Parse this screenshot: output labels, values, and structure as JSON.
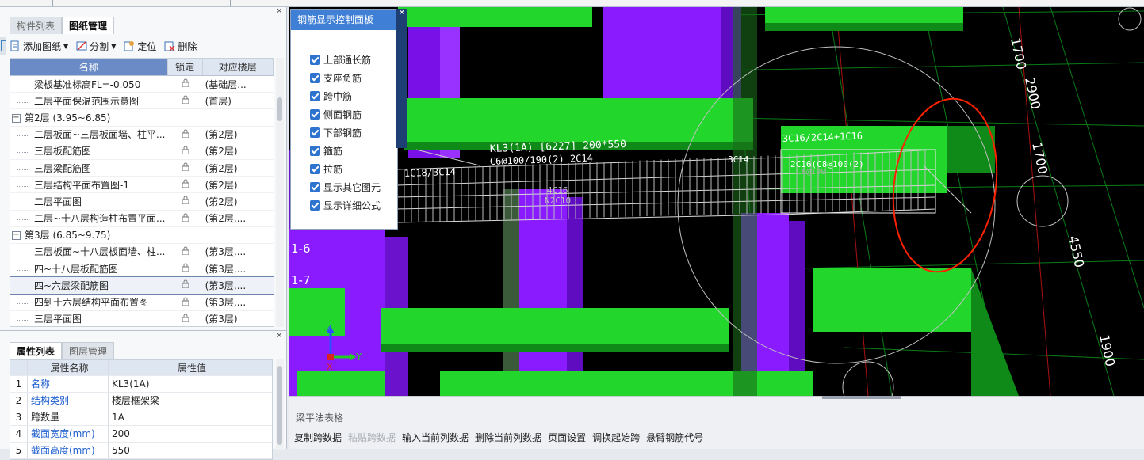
{
  "drawing_panel": {
    "tabs": [
      "构件列表",
      "图纸管理"
    ],
    "active_tab": 1,
    "toolbar": {
      "add_drawing": "添加图纸",
      "split": "分割",
      "locate": "定位",
      "delete": "删除"
    },
    "columns": {
      "name": "名称",
      "lock": "锁定",
      "floor": "对应楼层"
    },
    "rows": [
      {
        "type": "item",
        "name": "梁板基准标高FL=-0.050",
        "floor": "(基础层..."
      },
      {
        "type": "item",
        "name": "二层平面保温范围示意图",
        "floor": "(首层)"
      },
      {
        "type": "group",
        "name": "第2层 (3.95~6.85)",
        "floor": ""
      },
      {
        "type": "item",
        "name": "二层板面~三层板面墙、柱平...",
        "floor": "(第2层)"
      },
      {
        "type": "item",
        "name": "三层板配筋图",
        "floor": "(第2层)"
      },
      {
        "type": "item",
        "name": "三层梁配筋图",
        "floor": "(第2层)"
      },
      {
        "type": "item",
        "name": "三层结构平面布置图-1",
        "floor": "(第2层)"
      },
      {
        "type": "item",
        "name": "二层平面图",
        "floor": "(第2层)"
      },
      {
        "type": "item",
        "name": "二层~十八层构造柱布置平面...",
        "floor": "(第2层,..."
      },
      {
        "type": "group",
        "name": "第3层 (6.85~9.75)",
        "floor": ""
      },
      {
        "type": "item",
        "name": "三层板面~十八层板面墙、柱...",
        "floor": "(第3层,..."
      },
      {
        "type": "item",
        "name": "四~十八层板配筋图",
        "floor": "(第3层,..."
      },
      {
        "type": "item",
        "name": "四~六层梁配筋图",
        "floor": "(第3层,...",
        "selected": true
      },
      {
        "type": "item",
        "name": "四到十六层结构平面布置图",
        "floor": "(第3层,..."
      },
      {
        "type": "item",
        "name": "三层平面图",
        "floor": "(第3层)"
      }
    ]
  },
  "property_panel": {
    "tabs": [
      "属性列表",
      "图层管理"
    ],
    "active_tab": 0,
    "columns": {
      "name": "属性名称",
      "value": "属性值"
    },
    "rows": [
      {
        "idx": "1",
        "name": "名称",
        "value": "KL3(1A)",
        "blue": true
      },
      {
        "idx": "2",
        "name": "结构类别",
        "value": "楼层框架梁",
        "blue": true
      },
      {
        "idx": "3",
        "name": "跨数量",
        "value": "1A",
        "blue": false
      },
      {
        "idx": "4",
        "name": "截面宽度(mm)",
        "value": "200",
        "blue": true
      },
      {
        "idx": "5",
        "name": "截面高度(mm)",
        "value": "550",
        "blue": true
      }
    ]
  },
  "rebar_panel": {
    "title": "钢筋显示控制面板",
    "options": [
      "上部通长筋",
      "支座负筋",
      "跨中筋",
      "侧面钢筋",
      "下部钢筋",
      "箍筋",
      "拉筋",
      "显示其它图元",
      "显示详细公式"
    ]
  },
  "viewport": {
    "beam_label_1": "KL3(1A) [6227] 200*550",
    "beam_label_2": "C6@100/190(2) 2C14",
    "left_rebar_text": "1C18/3C14",
    "right_rebar_text": "3C16/2C14+1C16",
    "mid_text_1": "4C16",
    "mid_text_2": "N2C10",
    "small_text_1": "3C14",
    "small_text_2": "2C16(C8@100(2)",
    "small_text_3": "C8@100",
    "dims": [
      "1700",
      "2900",
      "1700",
      "4550",
      "1900"
    ],
    "axis_left_1": "1-6",
    "axis_left_2": "1-7",
    "axis_y": "Y",
    "axis_z": "Z",
    "axis_x": "X"
  },
  "bottom_panel": {
    "title": "梁平法表格",
    "actions": [
      {
        "label": "复制跨数据",
        "enabled": true
      },
      {
        "label": "粘贴跨数据",
        "enabled": false
      },
      {
        "label": "输入当前列数据",
        "enabled": true
      },
      {
        "label": "删除当前列数据",
        "enabled": true
      },
      {
        "label": "页面设置",
        "enabled": true
      },
      {
        "label": "调换起始跨",
        "enabled": true
      },
      {
        "label": "悬臂钢筋代号",
        "enabled": true
      }
    ]
  },
  "colors": {
    "beam_green": "#22d62c",
    "column_purple": "#8a1bff",
    "highlight_red": "#ff2200",
    "panel_blue": "#3f7fd5"
  }
}
